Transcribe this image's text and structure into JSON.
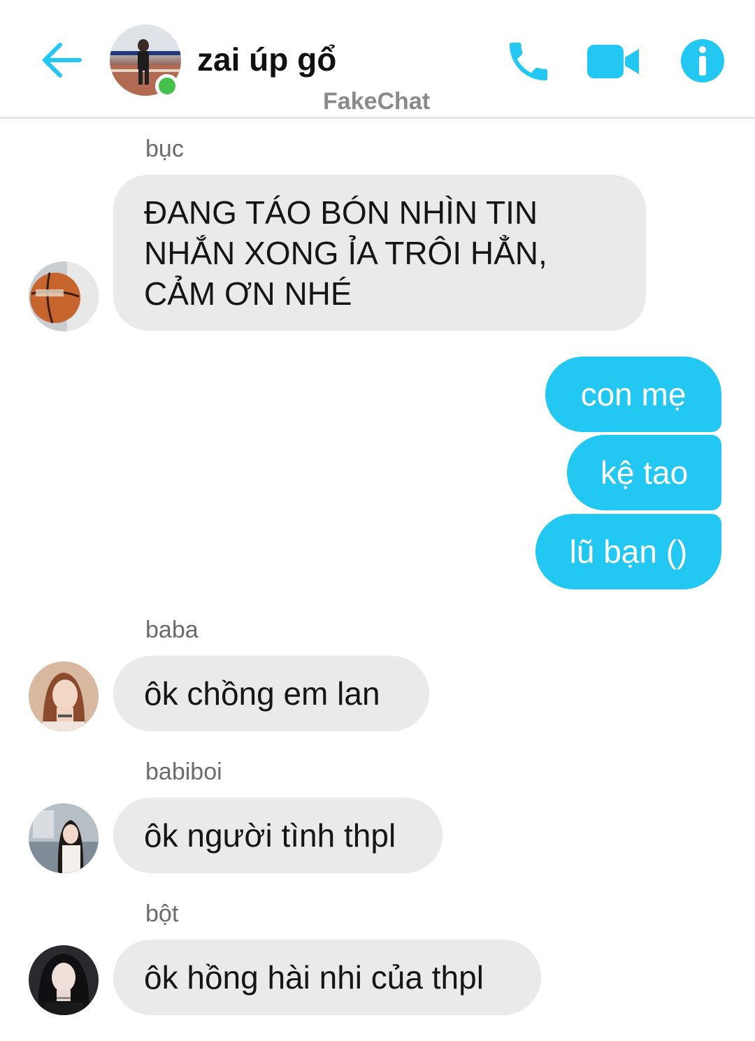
{
  "header": {
    "title": "zai úp gổ",
    "watermark": "FakeChat",
    "accent_color": "#22c8f1",
    "online_color": "#45c04b",
    "icons": [
      "back-arrow-icon",
      "phone-icon",
      "video-camera-icon",
      "info-icon"
    ]
  },
  "messages": {
    "m1": {
      "sender": "bục",
      "text": "ĐANG TÁO BÓN NHÌN TIN NHẮN XONG ỈA TRÔI HẲN, CẢM ƠN NHÉ"
    },
    "m2": {
      "text": "con mẹ"
    },
    "m3": {
      "text": "kệ tao"
    },
    "m4": {
      "text": "lũ bạn ()"
    },
    "m5": {
      "sender": "baba",
      "text": "ôk chồng em lan"
    },
    "m6": {
      "sender": "babiboi",
      "text": "ôk người tình thpl"
    },
    "m7": {
      "sender": "bột",
      "text": "ôk hồng hài nhi của thpl"
    }
  },
  "colors": {
    "incoming_bubble": "#eaeaea",
    "outgoing_bubble": "#22c8f1",
    "sender_name": "#6b6b6b"
  }
}
